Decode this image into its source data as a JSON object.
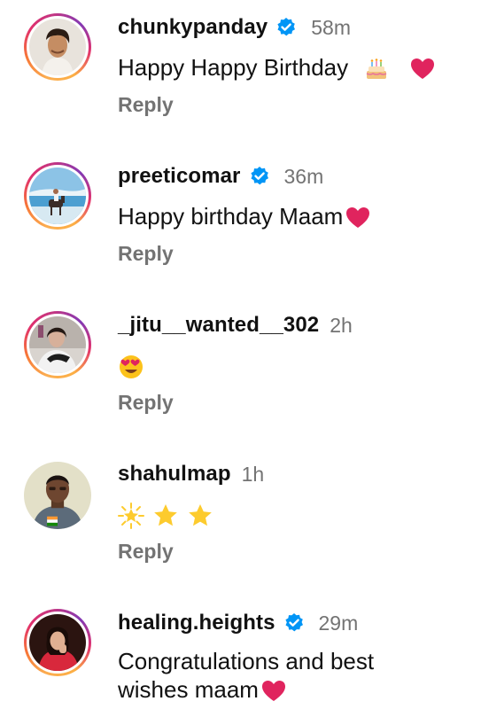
{
  "comments": [
    {
      "username": "chunkypanday",
      "verified": true,
      "time": "58m",
      "text": "Happy Happy Birthday",
      "emojis": [
        "cake-emoji",
        "red-heart-emoji"
      ],
      "reply_label": "Reply"
    },
    {
      "username": "preeticomar",
      "verified": true,
      "time": "36m",
      "text": "Happy birthday Maam",
      "emojis": [
        "red-heart-emoji"
      ],
      "reply_label": "Reply"
    },
    {
      "username": "_jitu__wanted__302",
      "verified": false,
      "time": "2h",
      "text": "",
      "emojis": [
        "heart-eyes-emoji"
      ],
      "reply_label": "Reply"
    },
    {
      "username": "shahulmap",
      "verified": false,
      "time": "1h",
      "text": "",
      "emojis": [
        "glowing-star-emoji",
        "star-emoji",
        "star-emoji"
      ],
      "reply_label": "Reply"
    },
    {
      "username": "healing.heights",
      "verified": true,
      "time": "29m",
      "text_line1": "Congratulations and best",
      "text_line2": "wishes maam",
      "emojis": [
        "red-heart-emoji"
      ],
      "reply_label": ""
    }
  ],
  "colors": {
    "text": "#111111",
    "secondary": "#737373",
    "verified_badge": "#0095f6",
    "heart": "#e0245e",
    "star": "#fdcb2e"
  }
}
